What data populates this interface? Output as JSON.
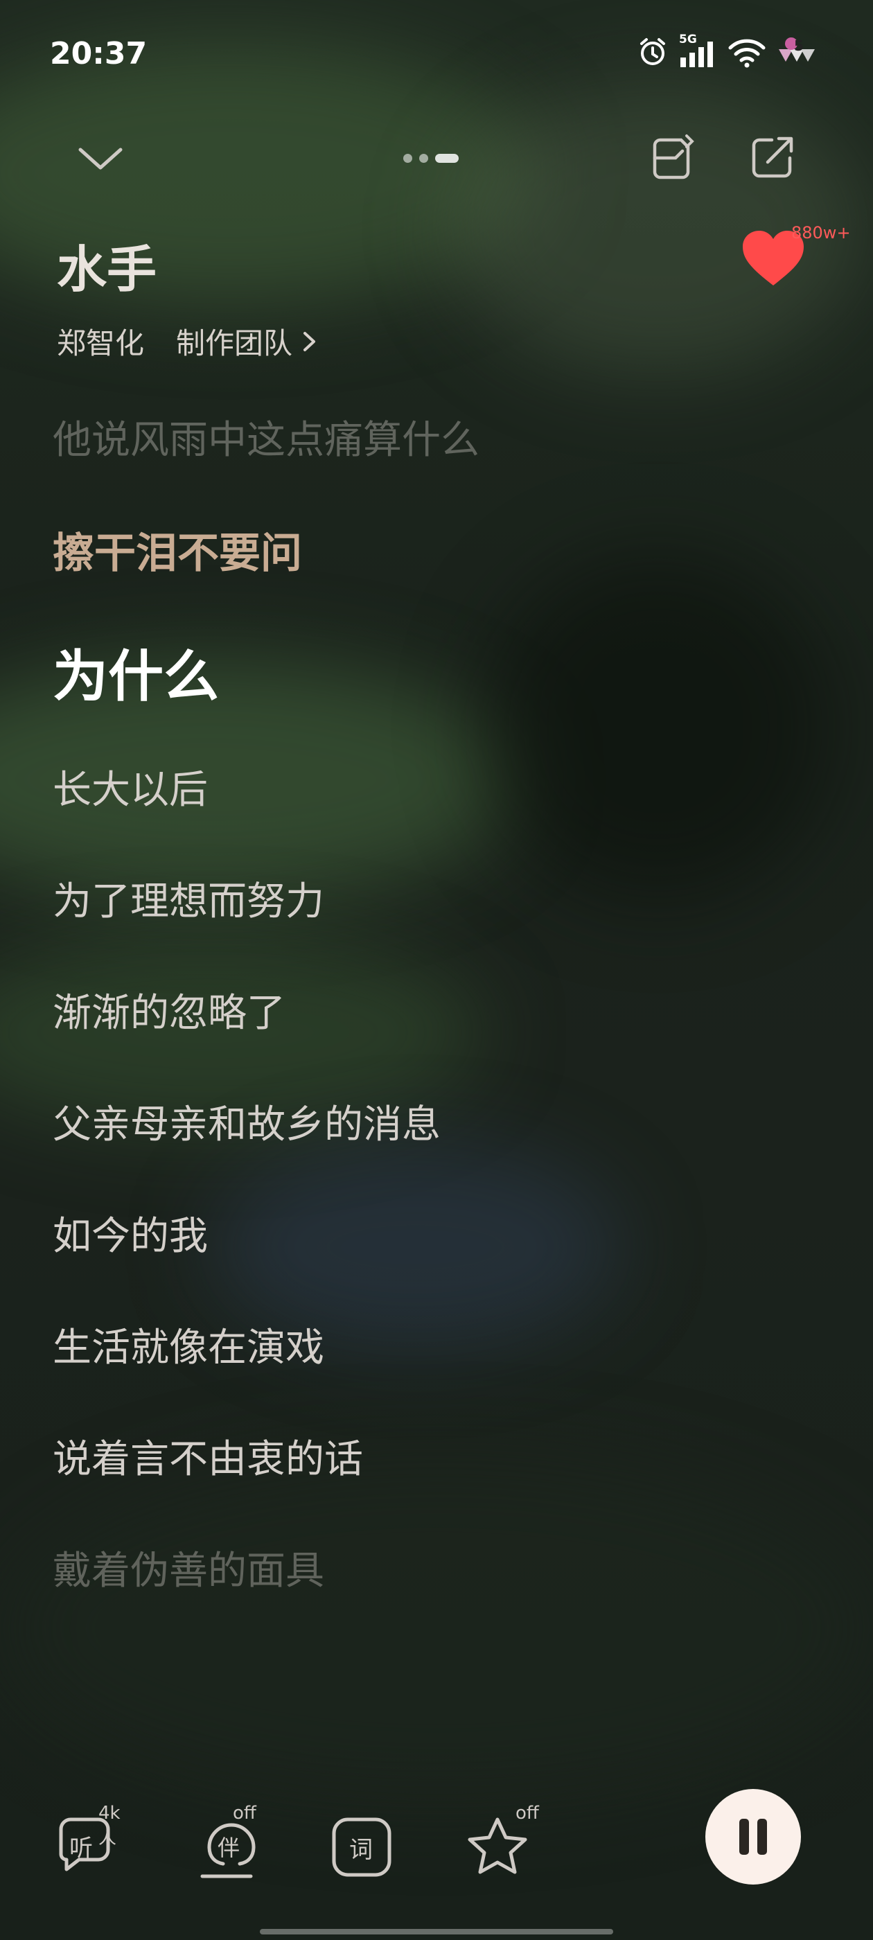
{
  "status_bar": {
    "time": "20:37",
    "network": "5G",
    "icons": [
      "alarm-icon",
      "signal-icon",
      "wifi-icon",
      "app-notification-icon"
    ]
  },
  "top": {
    "collapse_icon": "chevron-down-icon",
    "page_indicator": {
      "count": 3,
      "active_index": 2
    },
    "poster_icon": "poster-card-icon",
    "share_icon": "share-icon"
  },
  "song": {
    "title": "水手",
    "artist": "郑智化",
    "credits_link": "制作团队",
    "like_count": "880w+",
    "liked": true
  },
  "lyrics": [
    {
      "text": "他说风雨中这点痛算什么",
      "state": "dim"
    },
    {
      "text": "擦干泪不要问",
      "state": "prev"
    },
    {
      "text": "为什么",
      "state": "current"
    },
    {
      "text": "长大以后",
      "state": "normal"
    },
    {
      "text": "为了理想而努力",
      "state": "normal"
    },
    {
      "text": "渐渐的忽略了",
      "state": "normal"
    },
    {
      "text": "父亲母亲和故乡的消息",
      "state": "normal"
    },
    {
      "text": "如今的我",
      "state": "normal"
    },
    {
      "text": "生活就像在演戏",
      "state": "normal"
    },
    {
      "text": "说着言不由衷的话",
      "state": "normal"
    },
    {
      "text": "戴着伪善的面具",
      "state": "dim"
    }
  ],
  "bottom_tools": {
    "listen": {
      "label": "听",
      "badge": "4k人"
    },
    "accompany": {
      "label": "伴",
      "badge": "off"
    },
    "lyrics": {
      "label": "词"
    },
    "effect": {
      "badge": "off"
    }
  },
  "colors": {
    "like": "#ff4a4a",
    "current_lyric": "#ffffff",
    "previous_lyric": "#c9ac93",
    "play_button_bg": "#fbf0ea"
  },
  "player": {
    "state": "playing"
  }
}
